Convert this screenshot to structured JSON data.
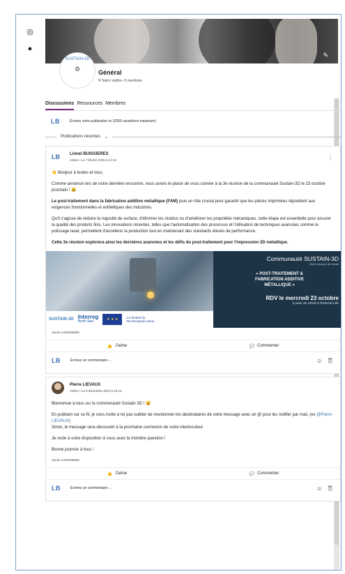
{
  "group": {
    "logo_text": "SUSTAIN-3D",
    "name": "Général",
    "meta": "Salon visible • 5 membres"
  },
  "tabs": [
    {
      "label": "Discussions"
    },
    {
      "label": "Ressources"
    },
    {
      "label": "Membres"
    }
  ],
  "composer": {
    "avatar": "LB",
    "placeholder": "Écrivez votre publication ici (2000 caractères maximum)"
  },
  "feed": {
    "section_label": "Publications récentes"
  },
  "post1": {
    "avatar": "LB",
    "author": "Lionel BUISSIERES",
    "meta": "Admin • Le 7 février 2025 à 12:13",
    "greeting": "👋 Bonjour à toutes et tous,",
    "p1": "Comme annoncé lors de notre dernière rencontre, nous avons le plaisir de vous convier à la 3e réunion de la communauté Sustain-3D le 23 octobre prochain ! 😀",
    "p2_bold": "Le post-traitement dans la fabrication additive métallique (FAM)",
    "p2_rest": " joue un rôle crucial pour garantir que les pièces imprimées répondent aux exigences fonctionnelles et esthétiques des industries.",
    "p3": "Qu'il s'agisse de réduire la rugosité de surface, d'éliminer les résidus ou d'améliorer les propriétés mécaniques, cette étape est essentielle pour assurer la qualité des produits finis. Les innovations récentes, telles que l'automatisation des processus et l'utilisation de techniques avancées comme le polissage laser, permettent d'accélérer la production tout en maintenant des standards élevés de performance.",
    "p4_bold": "Cette 3e réunion explorera ainsi les dernières avancées et les défis du post-traitement pour l'impression 3D métallique.",
    "promo": {
      "title": "Communauté SUSTAIN-3D",
      "subtitle": "3ème session de travail",
      "headline_1": "« POST-TRAITEMENT &",
      "headline_2": "FABRICATION ADDITIVE",
      "headline_3": "MÉTALLIQUE »",
      "date": "RDV le mercredi 23 octobre",
      "place": "à partir de 13h30 à l'ENSAM Lille",
      "sustain": "SUSTAIN-3D",
      "interreg": "Interreg",
      "interreg_sub": "North Sea",
      "eu_flag": "★ ★ ★",
      "eu_text_1": "Co-funded by",
      "eu_text_2": "the European Union"
    },
    "comments_label": "Aucun commentaire",
    "like_label": "J'aime",
    "comment_label": "Commenter",
    "reply_avatar": "LB",
    "reply_placeholder": "Écrivez un commentaire ..."
  },
  "post2": {
    "author": "Pierre LIEVAUX",
    "meta": "Admin • Le 6 décembre 2024 à 10:13",
    "p1": "Bienvenue à tous sur la communauté Sustain 3D ! 😀",
    "p2_a": "En publiant sur ce fil, je vous invite à ne pas oublier de mentionner les destinataires de votre message avec un @ pour les notifier par mail. (ex ",
    "p2_mention": "@Pierre LIEVAUX",
    "p2_b": ")",
    "p2_c": "Sinon, le message sera découvert à la prochaine connexion de votre interlocuteur.",
    "p3": "Je reste à votre disposition si vous avez la moindre question !",
    "p4": "Bonne journée à tous !",
    "comments_label": "Aucun commentaire",
    "like_label": "J'aime",
    "comment_label": "Commenter",
    "reply_avatar": "LB",
    "reply_placeholder": "Écrivez un commentaire ..."
  },
  "icons": {
    "like": "👍",
    "comment": "💬",
    "emoji": "☺",
    "attach": "🖺",
    "more": "⋮",
    "chevron": "⌄",
    "shield": "⛨"
  }
}
